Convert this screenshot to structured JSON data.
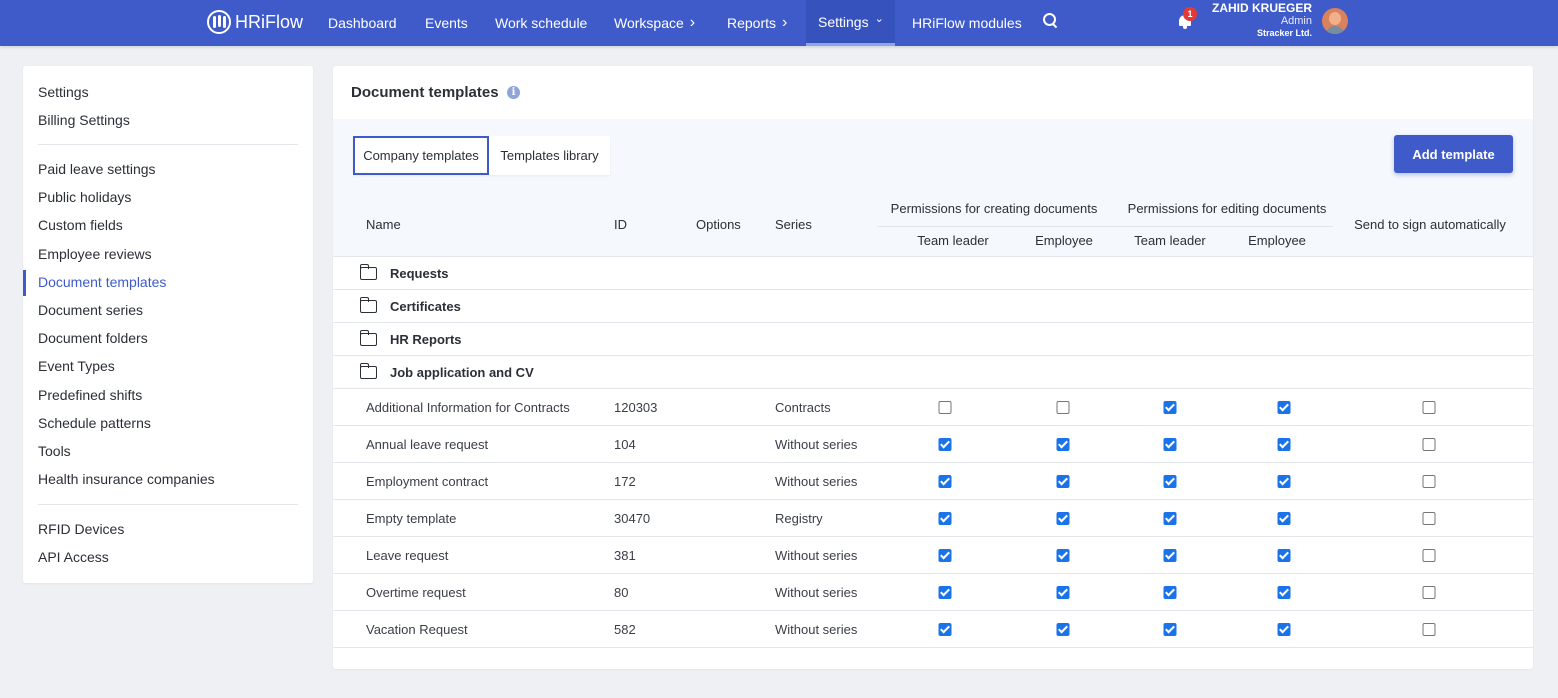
{
  "brand": {
    "name": "HRiFlow"
  },
  "nav": {
    "items": [
      {
        "label": "Dashboard",
        "chevron": false
      },
      {
        "label": "Events",
        "chevron": false
      },
      {
        "label": "Work schedule",
        "chevron": false
      },
      {
        "label": "Workspace",
        "chevron": true
      },
      {
        "label": "Reports",
        "chevron": true
      },
      {
        "label": "Settings",
        "chevron": true,
        "active": true
      },
      {
        "label": "HRiFlow modules",
        "chevron": false
      }
    ],
    "chevron_right": "›",
    "chevron_down": "⌄"
  },
  "notifications": {
    "count": "1"
  },
  "user": {
    "name": "ZAHID KRUEGER",
    "role": "Admin",
    "company": "Stracker Ltd."
  },
  "sidebar": {
    "group1": [
      "Settings",
      "Billing Settings"
    ],
    "group2": [
      "Paid leave settings",
      "Public holidays",
      "Custom fields",
      "Employee reviews",
      "Document templates",
      "Document series",
      "Document folders",
      "Event Types",
      "Predefined shifts",
      "Schedule patterns",
      "Tools",
      "Health insurance companies"
    ],
    "group3": [
      "RFID Devices",
      "API Access"
    ],
    "active": "Document templates"
  },
  "main": {
    "title": "Document templates",
    "info_glyph": "i",
    "tabs": [
      "Company templates",
      "Templates library"
    ],
    "active_tab": "Company templates",
    "add_button": "Add template"
  },
  "table": {
    "headers": {
      "name": "Name",
      "id": "ID",
      "options": "Options",
      "series": "Series",
      "perm_create": "Permissions for creating documents",
      "perm_edit": "Permissions for editing documents",
      "team_leader": "Team leader",
      "employee": "Employee",
      "send_sign": "Send to sign automatically"
    },
    "folders": [
      "Requests",
      "Certificates",
      "HR Reports",
      "Job application and CV"
    ],
    "rows": [
      {
        "name": "Additional Information for Contracts",
        "id": "120303",
        "series": "Contracts",
        "create_tl": false,
        "create_emp": false,
        "edit_tl": true,
        "edit_emp": true,
        "send_sign": false
      },
      {
        "name": "Annual leave request",
        "id": "104",
        "series": "Without series",
        "create_tl": true,
        "create_emp": true,
        "edit_tl": true,
        "edit_emp": true,
        "send_sign": false
      },
      {
        "name": "Employment contract",
        "id": "172",
        "series": "Without series",
        "create_tl": true,
        "create_emp": true,
        "edit_tl": true,
        "edit_emp": true,
        "send_sign": false
      },
      {
        "name": "Empty template",
        "id": "30470",
        "series": "Registry",
        "create_tl": true,
        "create_emp": true,
        "edit_tl": true,
        "edit_emp": true,
        "send_sign": false
      },
      {
        "name": "Leave request",
        "id": "381",
        "series": "Without series",
        "create_tl": true,
        "create_emp": true,
        "edit_tl": true,
        "edit_emp": true,
        "send_sign": false
      },
      {
        "name": "Overtime request",
        "id": "80",
        "series": "Without series",
        "create_tl": true,
        "create_emp": true,
        "edit_tl": true,
        "edit_emp": true,
        "send_sign": false
      },
      {
        "name": "Vacation Request",
        "id": "582",
        "series": "Without series",
        "create_tl": true,
        "create_emp": true,
        "edit_tl": true,
        "edit_emp": true,
        "send_sign": false
      }
    ]
  },
  "colors": {
    "primary": "#3f5bc9",
    "checkbox": "#1a73e8",
    "badge": "#e53935"
  }
}
